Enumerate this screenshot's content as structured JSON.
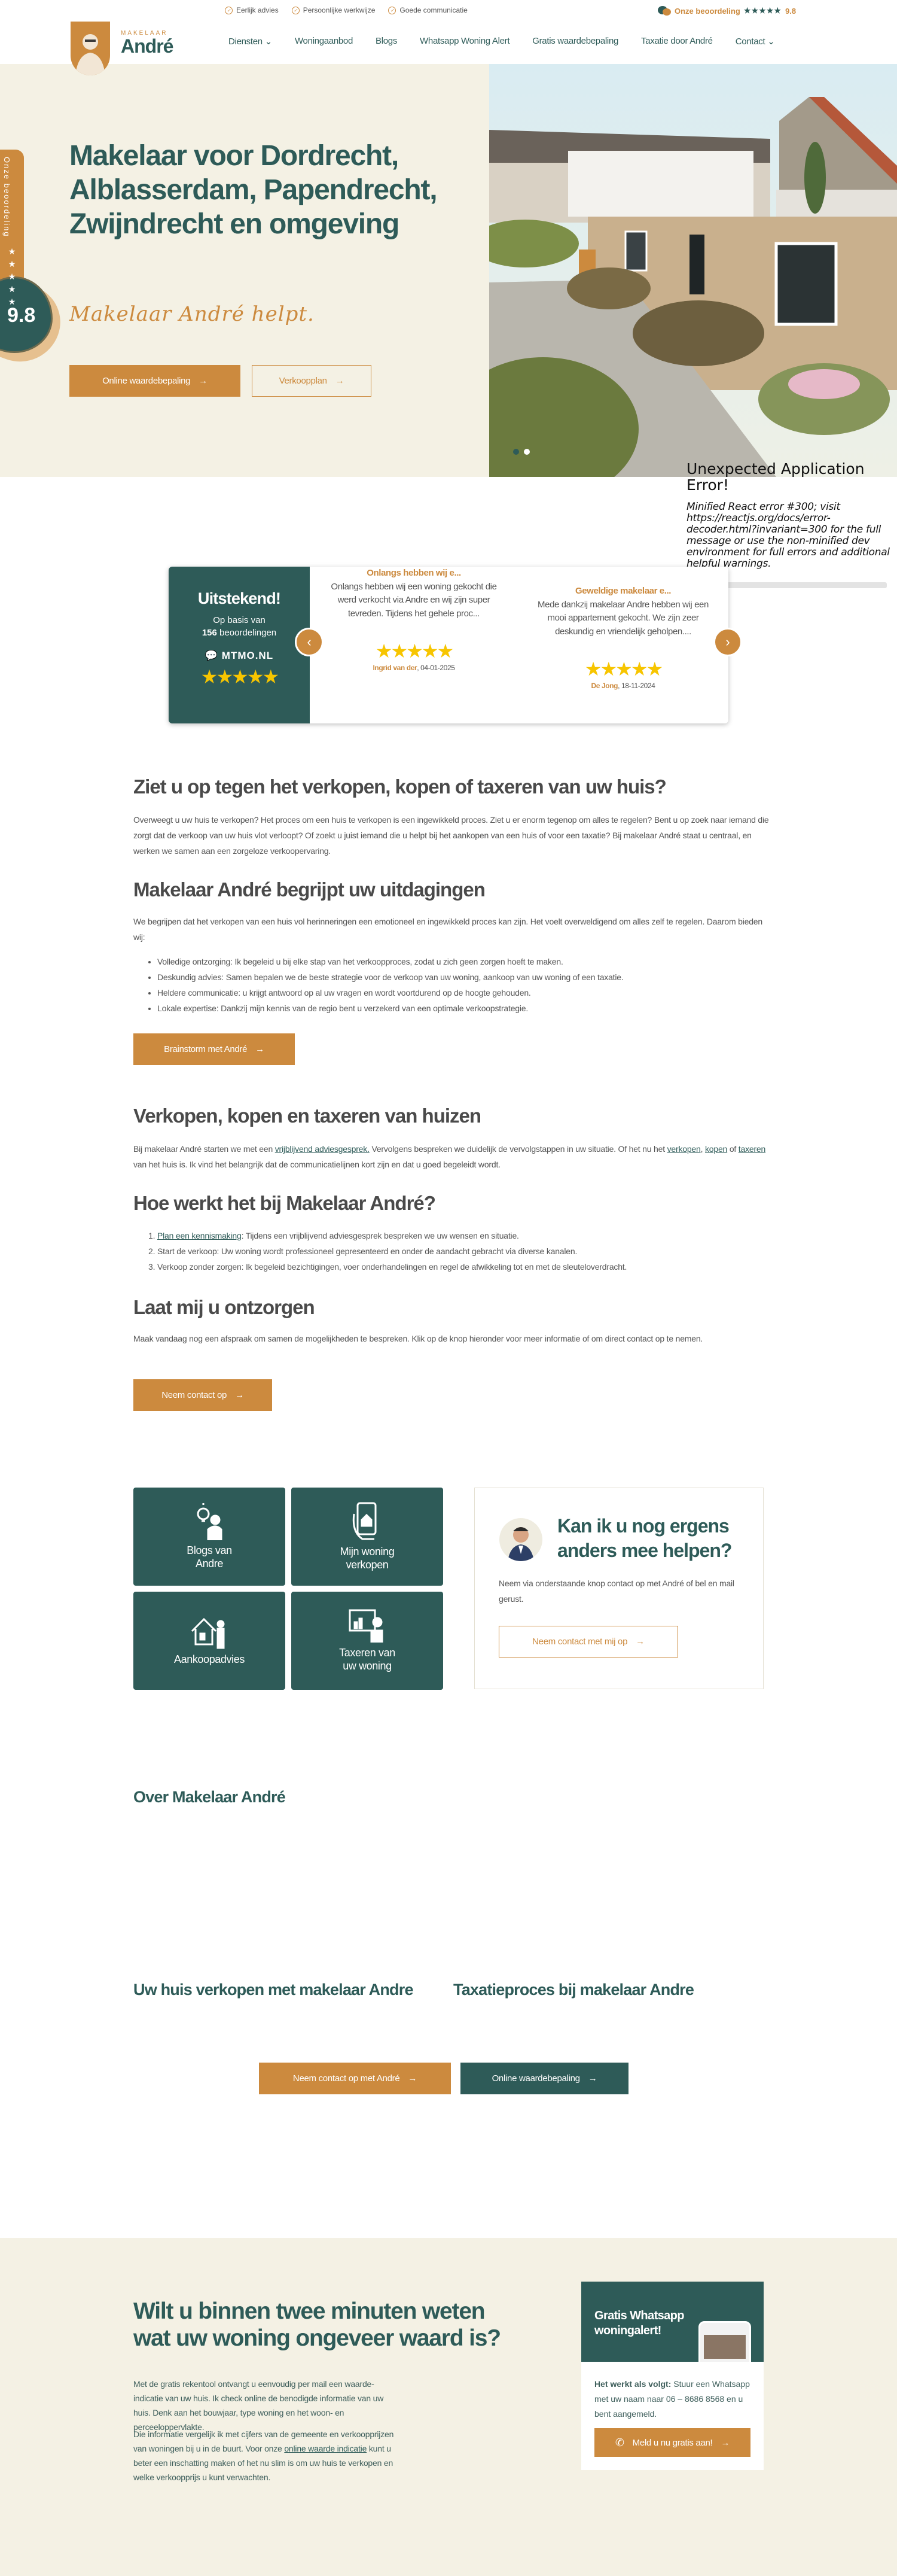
{
  "colors": {
    "brand_green": "#2e5b58",
    "brand_orange": "#cc8a3e",
    "cream": "#f4f1e4",
    "star_yellow": "#f7c500"
  },
  "topbar": {
    "trust_items": [
      "Eerlijk advies",
      "Persoonlijke werkwijze",
      "Goede communicatie"
    ],
    "rating_label": "Onze beoordeling",
    "rating_stars": "★★★★★",
    "rating_value": "9.8"
  },
  "logo": {
    "small": "MAKELAAR",
    "big": "André"
  },
  "nav": {
    "items": [
      {
        "label": "Diensten",
        "dropdown": true
      },
      {
        "label": "Woningaanbod"
      },
      {
        "label": "Blogs"
      },
      {
        "label": "Whatsapp Woning Alert"
      },
      {
        "label": "Gratis waardebepaling"
      },
      {
        "label": "Taxatie door André"
      },
      {
        "label": "Contact",
        "dropdown": true
      }
    ]
  },
  "hero": {
    "title": "Makelaar voor Dordrecht, Alblasserdam, Papendrecht, Zwijndrecht en omgeving",
    "script": "Makelaar André helpt.",
    "primary_button": "Online waardebepaling",
    "secondary_button": "Verkoopplan",
    "rating_tab_label": "Onze beoordeling",
    "rating_tab_stars": "★★★★★",
    "rating_tab_value": "9.8",
    "slider_dots": 2,
    "slider_active": 1
  },
  "error": {
    "title": "Unexpected Application Error!",
    "message": "Minified React error #300; visit https://reactjs.org/docs/error-decoder.html?invariant=300 for the full message or use the non-minified dev environment for full errors and additional helpful warnings."
  },
  "reviews": {
    "summary_title": "Uitstekend!",
    "summary_basis": "Op basis van",
    "summary_count": "156",
    "summary_count_label": "beoordelingen",
    "source": "MTMO.NL",
    "stars": "★★★★★",
    "items": [
      {
        "title": "Onlangs hebben wij e...",
        "text": "Onlangs hebben wij een woning gekocht die werd verkocht via Andre en wij zijn super tevreden. Tijdens het gehele proc...",
        "stars": "★★★★★",
        "author": "Ingrid van der",
        "date": ", 04-01-2025"
      },
      {
        "title": "Geweldige makelaar e...",
        "text": "Mede dankzij makelaar Andre hebben wij een mooi appartement gekocht. We zijn zeer deskundig en vriendelijk geholpen....",
        "stars": "★★★★★",
        "author": "De Jong",
        "date": ", 18-11-2024"
      }
    ]
  },
  "sections": {
    "s1_title": "Ziet u op tegen het verkopen, kopen of taxeren van uw huis?",
    "s1_text": "Overweegt u uw huis te verkopen? Het proces om een huis te verkopen is een ingewikkeld proces. Ziet u er enorm tegenop om alles te regelen? Bent u op zoek naar iemand die zorgt dat de verkoop van uw huis vlot verloopt? Of zoekt u juist iemand die u helpt bij het aankopen van een huis of voor een taxatie? Bij makelaar André staat u centraal, en werken we samen aan een zorgeloze verkoopervaring.",
    "s2_title": "Makelaar André begrijpt uw uitdagingen",
    "s2_text": "We begrijpen dat het verkopen van een huis vol herinneringen een emotioneel en ingewikkeld proces kan zijn. Het voelt overweldigend om alles zelf te regelen. Daarom bieden wij:",
    "s2_bullets": [
      "Volledige ontzorging: Ik begeleid u bij elke stap van het verkoopproces, zodat u zich geen zorgen hoeft te maken.",
      "Deskundig advies: Samen bepalen we de beste strategie voor de verkoop van uw woning, aankoop van uw woning of een taxatie.",
      "Heldere communicatie: u krijgt antwoord op al uw vragen en wordt voortdurend op de hoogte gehouden.",
      "Lokale expertise: Dankzij mijn kennis van de regio bent u verzekerd van een optimale verkoopstrategie."
    ],
    "s2_button": "Brainstorm met André",
    "s3_title": "Verkopen, kopen en taxeren van huizen",
    "s3_text_a": "Bij makelaar André starten we met een ",
    "s3_link_advies": "vrijblijvend adviesgesprek.",
    "s3_text_b": " Vervolgens bespreken we duidelijk de vervolgstappen in uw situatie. Of het nu het ",
    "s3_link_verkopen": "verkopen",
    "s3_sep1": ", ",
    "s3_link_kopen": "kopen",
    "s3_sep2": " of ",
    "s3_link_taxeren": "taxeren",
    "s3_text_c": " van het huis is. Ik vind het belangrijk dat de communicatielijnen kort zijn en dat u goed begeleidt wordt.",
    "s4_title": "Hoe werkt het bij Makelaar André?",
    "s4_step1_link": "Plan een kennismaking",
    "s4_step1_text": ": Tijdens een vrijblijvend adviesgesprek bespreken we uw wensen en situatie.",
    "s4_step2": "Start de verkoop: Uw woning wordt professioneel gepresenteerd en onder de aandacht gebracht via diverse kanalen.",
    "s4_step3": "Verkoop zonder zorgen: Ik begeleid bezichtigingen, voer onderhandelingen en regel de afwikkeling tot en met de sleuteloverdracht.",
    "s5_title": "Laat mij u ontzorgen",
    "s5_text": "Maak vandaag nog een afspraak om samen de mogelijkheden te bespreken. Klik op de knop hieronder voor meer informatie of om direct contact op te nemen.",
    "s5_button": "Neem contact op"
  },
  "tiles": [
    {
      "label": "Blogs van Andre",
      "icon": "lightbulb-person-icon"
    },
    {
      "label": "Mijn woning verkopen",
      "icon": "phone-house-icon"
    },
    {
      "label": "Aankoopadvies",
      "icon": "house-person-icon"
    },
    {
      "label": "Taxeren van uw woning",
      "icon": "chart-presenter-icon"
    }
  ],
  "contact": {
    "title": "Kan ik u nog ergens anders mee helpen?",
    "text": "Neem via onderstaande knop contact op met André of bel en mail gerust.",
    "button": "Neem contact met mij op"
  },
  "about": {
    "title": "Over Makelaar André",
    "col1_title": "Uw huis verkopen met makelaar Andre",
    "col2_title": "Taxatieproces bij makelaar Andre",
    "button_contact": "Neem contact op met André",
    "button_value": "Online waardebepaling"
  },
  "valuation": {
    "title": "Wilt u binnen twee minuten weten wat uw woning ongeveer waard is?",
    "p1": "Met de gratis rekentool ontvangt u eenvoudig per mail een waarde-indicatie van uw huis. Ik check online de benodigde informatie van uw huis. Denk aan het bouwjaar, type woning en het woon- en perceeloppervlakte.",
    "p2_a": "Die informatie vergelijk ik met cijfers van de gemeente en verkoopprijzen van woningen bij u in de buurt. Voor onze ",
    "p2_link": "online waarde indicatie",
    "p2_b": " kunt u beter een inschatting maken of het nu slim is om uw huis te verkopen en welke verkoopprijs u kunt verwachten."
  },
  "whatsapp_card": {
    "title": "Gratis Whatsapp woningalert!",
    "bold": "Het werkt als volgt:",
    "text": " Stuur een Whatsapp met uw naam naar 06 – 8686 8568 en u bent aangemeld.",
    "button": "Meld u nu gratis aan!"
  }
}
